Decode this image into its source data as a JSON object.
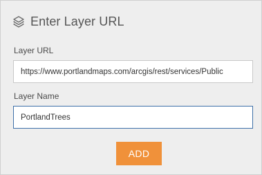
{
  "dialog": {
    "title": "Enter Layer URL",
    "header_icon": "layers-icon"
  },
  "layer_url": {
    "label": "Layer URL",
    "value": "https://www.portlandmaps.com/arcgis/rest/services/Public"
  },
  "layer_name": {
    "label": "Layer Name",
    "value": "PortlandTrees"
  },
  "actions": {
    "add_label": "ADD"
  },
  "colors": {
    "panel_background": "#eeeeee",
    "add_button": "#f0913a",
    "focused_border": "#3d6fa8"
  }
}
